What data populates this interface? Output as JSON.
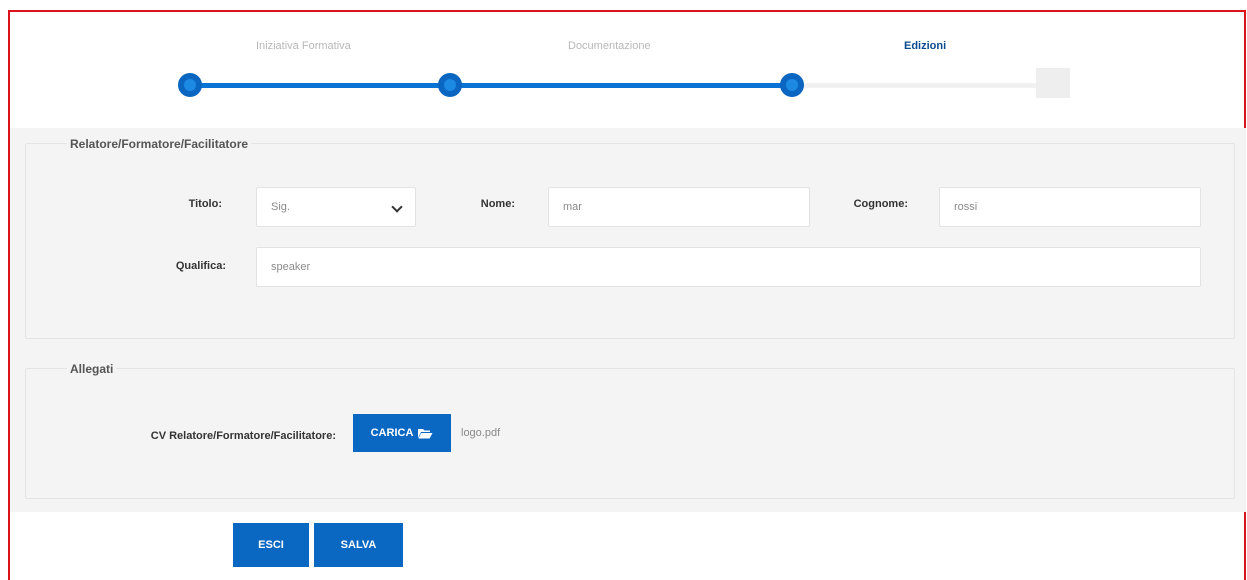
{
  "stepper": {
    "steps": [
      {
        "label": "Iniziativa Formativa",
        "state": "done"
      },
      {
        "label": "Documentazione",
        "state": "done"
      },
      {
        "label": "Edizioni",
        "state": "active"
      }
    ],
    "accent_color": "#0a74d6"
  },
  "relatore": {
    "legend": "Relatore/Formatore/Facilitatore",
    "titolo": {
      "label": "Titolo:",
      "value": "Sig."
    },
    "nome": {
      "label": "Nome:",
      "value": "mar"
    },
    "cognome": {
      "label": "Cognome:",
      "value": "rossi"
    },
    "qualifica": {
      "label": "Qualifica:",
      "value": "speaker"
    }
  },
  "allegati": {
    "legend": "Allegati",
    "cv_label": "CV Relatore/Formatore/Facilitatore:",
    "upload_label": "CARICA",
    "upload_icon": "folder-open-icon",
    "file_name": "logo.pdf"
  },
  "actions": {
    "exit_label": "ESCI",
    "save_label": "SALVA",
    "button_color": "#0a67c2"
  }
}
